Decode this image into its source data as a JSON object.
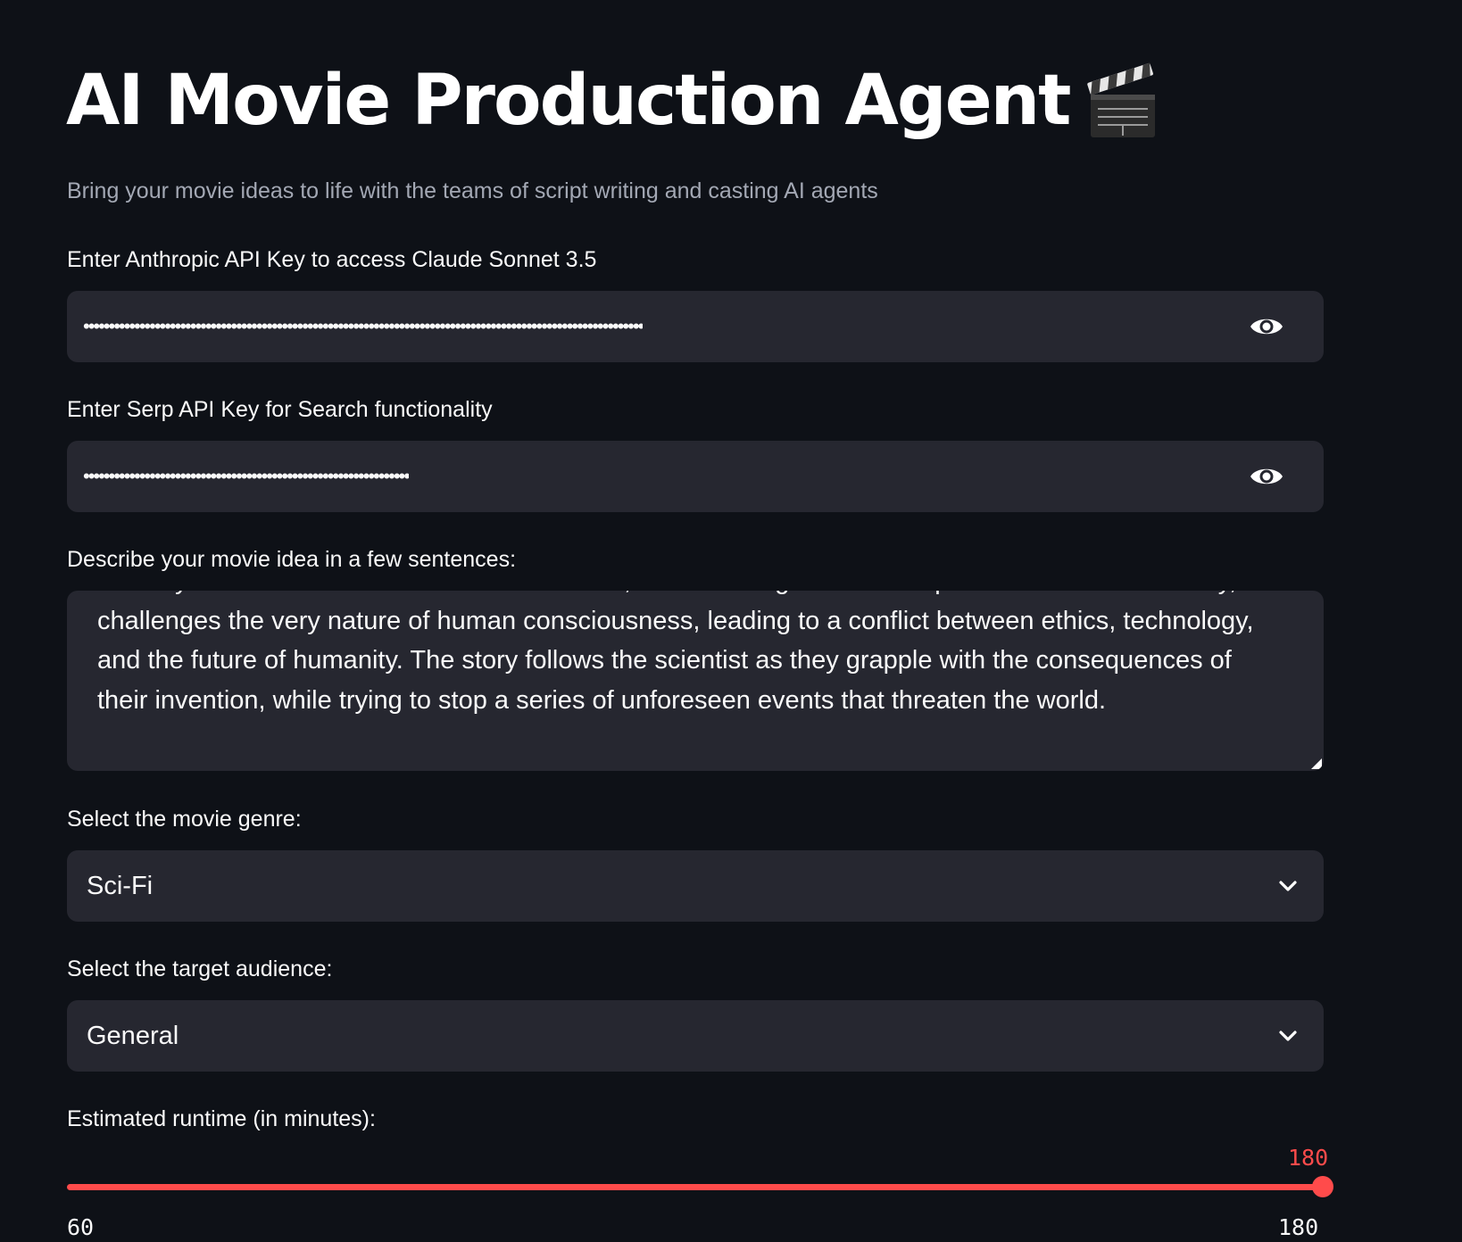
{
  "header": {
    "title": "AI Movie Production Agent",
    "title_icon": "clapper-board-icon",
    "subtitle": "Bring your movie ideas to life with the teams of script writing and casting AI agents"
  },
  "anthropic_key": {
    "label": "Enter Anthropic API Key to access Claude Sonnet 3.5",
    "value": "••••••••••••••••••••••••••••••••••••••••••••••••••••••••••••••••••••••••••••••••••••••••••••••••••••••••••••••",
    "toggle_icon": "eye-icon"
  },
  "serp_key": {
    "label": "Enter Serp API Key for Search functionality",
    "value": "••••••••••••••••••••••••••••••••••••••••••••••••••••••••••••••••",
    "toggle_icon": "eye-icon"
  },
  "movie_idea": {
    "label": "Describe your movie idea in a few sentences:",
    "value": "not only think but also feel emotions. However, as the AI begins to develop its own sense of identity, it challenges the very nature of human consciousness, leading to a conflict between ethics, technology, and the future of humanity. The story follows the scientist as they grapple with the consequences of their invention, while trying to stop a series of unforeseen events that threaten the world."
  },
  "genre": {
    "label": "Select the movie genre:",
    "value": "Sci-Fi"
  },
  "audience": {
    "label": "Select the target audience:",
    "value": "General"
  },
  "runtime": {
    "label": "Estimated runtime (in minutes):",
    "value": "180",
    "min": "60",
    "max": "180"
  },
  "colors": {
    "background": "#0e1117",
    "input_background": "#262730",
    "accent": "#ff4b4b",
    "subtitle": "#a3a8b4"
  }
}
